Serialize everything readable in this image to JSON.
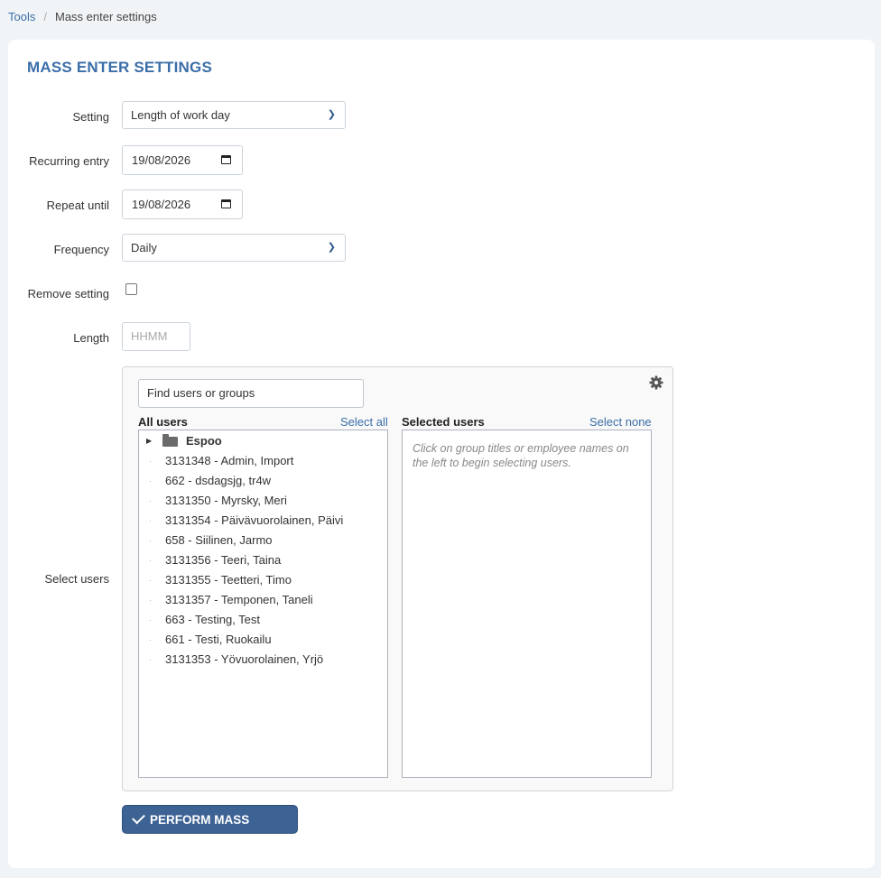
{
  "breadcrumb": {
    "root": "Tools",
    "separator": "/",
    "current": "Mass enter settings"
  },
  "title": "MASS ENTER SETTINGS",
  "form": {
    "setting": {
      "label": "Setting",
      "value": "Length of work day"
    },
    "recurring": {
      "label": "Recurring entry",
      "value": "19/08/2026"
    },
    "repeat_until": {
      "label": "Repeat until",
      "value": "19/08/2026"
    },
    "frequency": {
      "label": "Frequency",
      "value": "Daily"
    },
    "remove_setting": {
      "label": "Remove setting",
      "checked": false
    },
    "length": {
      "label": "Length",
      "placeholder": "HHMM"
    },
    "select_users_label": "Select users"
  },
  "users": {
    "search_placeholder": "Find users or groups",
    "all_header": "All users",
    "select_all": "Select all",
    "selected_header": "Selected users",
    "select_none": "Select none",
    "hint": "Click on group titles or employee names on the left to begin selecting users.",
    "group": "Espoo",
    "items": [
      "3131348 - Admin, Import",
      "662 - dsdagsjg, tr4w",
      "3131350 - Myrsky, Meri",
      "3131354 - Päivävuorolainen, Päivi",
      "658 - Siilinen, Jarmo",
      "3131356 - Teeri, Taina",
      "3131355 - Teetteri, Timo",
      "3131357 - Temponen, Taneli",
      "663 - Testing, Test",
      "661 - Testi, Ruokailu",
      "3131353 - Yövuorolainen, Yrjö"
    ]
  },
  "submit_label": "PERFORM MASS ENTRY",
  "colors": {
    "accent": "#3b6ea8",
    "button": "#3d6294"
  }
}
